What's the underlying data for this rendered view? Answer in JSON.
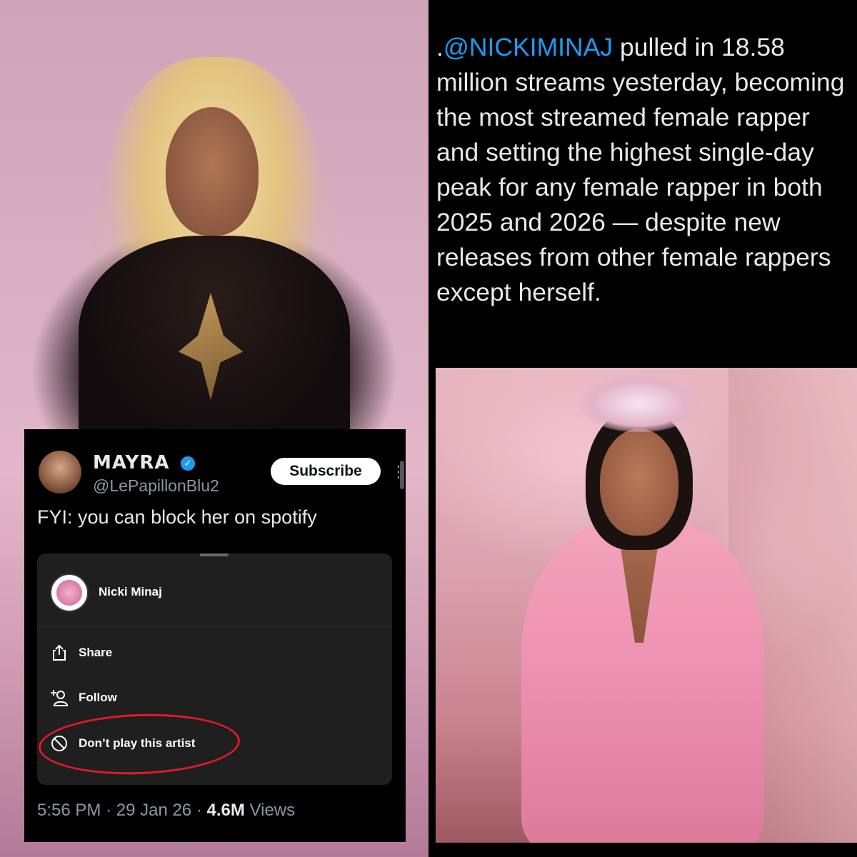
{
  "tweet_card": {
    "author_name": "MAYRA",
    "author_handle": "@LePapillonBlu2",
    "subscribe_label": "Subscribe",
    "more_icon": "more-vertical-icon",
    "text": "FYI: you can block her on spotify",
    "sheet": {
      "artist_name": "Nicki Minaj",
      "items": [
        {
          "label": "Share",
          "icon": "share-icon"
        },
        {
          "label": "Follow",
          "icon": "add-person-icon"
        },
        {
          "label": "Don’t play this artist",
          "icon": "block-icon"
        }
      ],
      "highlight_color": "#e0192a"
    },
    "meta": {
      "time": "5:56 PM",
      "separator": "·",
      "date": "29 Jan 26",
      "views_count": "4.6M",
      "views_label": "Views"
    }
  },
  "right_tweet": {
    "prefix": ".",
    "mention": "@NICKIMINAJ",
    "body": " pulled in 18.58 million streams yesterday, becoming the most streamed female rapper and setting the highest single-day peak for any female rapper in both 2025 and 2026 — despite new releases from other female rappers except herself."
  },
  "colors": {
    "link": "#1d9bf0",
    "background": "#000000",
    "text": "#e7e9ea",
    "muted": "#8b98a5"
  }
}
